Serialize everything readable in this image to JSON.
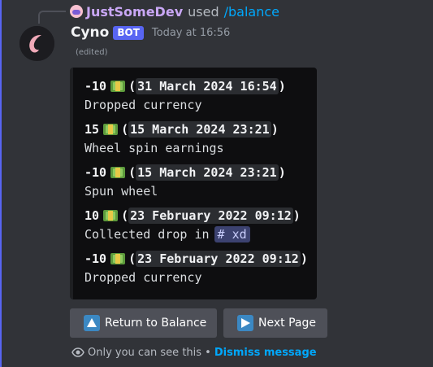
{
  "reply": {
    "user": "JustSomeDev",
    "used_text": "used",
    "command": "/balance"
  },
  "message": {
    "author": "Cyno",
    "bot_tag": "BOT",
    "timestamp": "Today at 16:56",
    "edited": "(edited)"
  },
  "entries": [
    {
      "amount": "-10",
      "date": "31 March 2024 16:54",
      "description": "Dropped currency",
      "channel": ""
    },
    {
      "amount": "15",
      "date": "15 March 2024 23:21",
      "description": "Wheel spin earnings",
      "channel": ""
    },
    {
      "amount": "-10",
      "date": "15 March 2024 23:21",
      "description": "Spun wheel",
      "channel": ""
    },
    {
      "amount": "10",
      "date": "23 February 2022 09:12",
      "description": "Collected drop in",
      "channel": "# xd"
    },
    {
      "amount": "-10",
      "date": "23 February 2022 09:12",
      "description": "Dropped currency",
      "channel": ""
    }
  ],
  "icons": {
    "currency": "dollar-banknote-icon",
    "back": "up-arrow-icon",
    "next": "play-icon",
    "visibility": "eye-icon"
  },
  "buttons": {
    "back_label": "Return to Balance",
    "next_label": "Next Page"
  },
  "footer": {
    "notice": "Only you can see this •",
    "dismiss": "Dismiss message"
  },
  "colors": {
    "accent": "#5865f2",
    "link": "#00a8fc",
    "username": "#c9a7f5",
    "button": "#4e5058"
  }
}
